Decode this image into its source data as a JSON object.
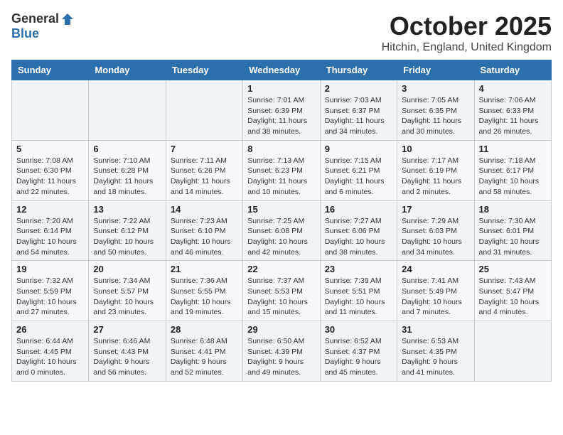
{
  "header": {
    "logo_general": "General",
    "logo_blue": "Blue",
    "month": "October 2025",
    "location": "Hitchin, England, United Kingdom"
  },
  "days_of_week": [
    "Sunday",
    "Monday",
    "Tuesday",
    "Wednesday",
    "Thursday",
    "Friday",
    "Saturday"
  ],
  "weeks": [
    [
      {
        "day": "",
        "info": ""
      },
      {
        "day": "",
        "info": ""
      },
      {
        "day": "",
        "info": ""
      },
      {
        "day": "1",
        "info": "Sunrise: 7:01 AM\nSunset: 6:39 PM\nDaylight: 11 hours\nand 38 minutes."
      },
      {
        "day": "2",
        "info": "Sunrise: 7:03 AM\nSunset: 6:37 PM\nDaylight: 11 hours\nand 34 minutes."
      },
      {
        "day": "3",
        "info": "Sunrise: 7:05 AM\nSunset: 6:35 PM\nDaylight: 11 hours\nand 30 minutes."
      },
      {
        "day": "4",
        "info": "Sunrise: 7:06 AM\nSunset: 6:33 PM\nDaylight: 11 hours\nand 26 minutes."
      }
    ],
    [
      {
        "day": "5",
        "info": "Sunrise: 7:08 AM\nSunset: 6:30 PM\nDaylight: 11 hours\nand 22 minutes."
      },
      {
        "day": "6",
        "info": "Sunrise: 7:10 AM\nSunset: 6:28 PM\nDaylight: 11 hours\nand 18 minutes."
      },
      {
        "day": "7",
        "info": "Sunrise: 7:11 AM\nSunset: 6:26 PM\nDaylight: 11 hours\nand 14 minutes."
      },
      {
        "day": "8",
        "info": "Sunrise: 7:13 AM\nSunset: 6:23 PM\nDaylight: 11 hours\nand 10 minutes."
      },
      {
        "day": "9",
        "info": "Sunrise: 7:15 AM\nSunset: 6:21 PM\nDaylight: 11 hours\nand 6 minutes."
      },
      {
        "day": "10",
        "info": "Sunrise: 7:17 AM\nSunset: 6:19 PM\nDaylight: 11 hours\nand 2 minutes."
      },
      {
        "day": "11",
        "info": "Sunrise: 7:18 AM\nSunset: 6:17 PM\nDaylight: 10 hours\nand 58 minutes."
      }
    ],
    [
      {
        "day": "12",
        "info": "Sunrise: 7:20 AM\nSunset: 6:14 PM\nDaylight: 10 hours\nand 54 minutes."
      },
      {
        "day": "13",
        "info": "Sunrise: 7:22 AM\nSunset: 6:12 PM\nDaylight: 10 hours\nand 50 minutes."
      },
      {
        "day": "14",
        "info": "Sunrise: 7:23 AM\nSunset: 6:10 PM\nDaylight: 10 hours\nand 46 minutes."
      },
      {
        "day": "15",
        "info": "Sunrise: 7:25 AM\nSunset: 6:08 PM\nDaylight: 10 hours\nand 42 minutes."
      },
      {
        "day": "16",
        "info": "Sunrise: 7:27 AM\nSunset: 6:06 PM\nDaylight: 10 hours\nand 38 minutes."
      },
      {
        "day": "17",
        "info": "Sunrise: 7:29 AM\nSunset: 6:03 PM\nDaylight: 10 hours\nand 34 minutes."
      },
      {
        "day": "18",
        "info": "Sunrise: 7:30 AM\nSunset: 6:01 PM\nDaylight: 10 hours\nand 31 minutes."
      }
    ],
    [
      {
        "day": "19",
        "info": "Sunrise: 7:32 AM\nSunset: 5:59 PM\nDaylight: 10 hours\nand 27 minutes."
      },
      {
        "day": "20",
        "info": "Sunrise: 7:34 AM\nSunset: 5:57 PM\nDaylight: 10 hours\nand 23 minutes."
      },
      {
        "day": "21",
        "info": "Sunrise: 7:36 AM\nSunset: 5:55 PM\nDaylight: 10 hours\nand 19 minutes."
      },
      {
        "day": "22",
        "info": "Sunrise: 7:37 AM\nSunset: 5:53 PM\nDaylight: 10 hours\nand 15 minutes."
      },
      {
        "day": "23",
        "info": "Sunrise: 7:39 AM\nSunset: 5:51 PM\nDaylight: 10 hours\nand 11 minutes."
      },
      {
        "day": "24",
        "info": "Sunrise: 7:41 AM\nSunset: 5:49 PM\nDaylight: 10 hours\nand 7 minutes."
      },
      {
        "day": "25",
        "info": "Sunrise: 7:43 AM\nSunset: 5:47 PM\nDaylight: 10 hours\nand 4 minutes."
      }
    ],
    [
      {
        "day": "26",
        "info": "Sunrise: 6:44 AM\nSunset: 4:45 PM\nDaylight: 10 hours\nand 0 minutes."
      },
      {
        "day": "27",
        "info": "Sunrise: 6:46 AM\nSunset: 4:43 PM\nDaylight: 9 hours\nand 56 minutes."
      },
      {
        "day": "28",
        "info": "Sunrise: 6:48 AM\nSunset: 4:41 PM\nDaylight: 9 hours\nand 52 minutes."
      },
      {
        "day": "29",
        "info": "Sunrise: 6:50 AM\nSunset: 4:39 PM\nDaylight: 9 hours\nand 49 minutes."
      },
      {
        "day": "30",
        "info": "Sunrise: 6:52 AM\nSunset: 4:37 PM\nDaylight: 9 hours\nand 45 minutes."
      },
      {
        "day": "31",
        "info": "Sunrise: 6:53 AM\nSunset: 4:35 PM\nDaylight: 9 hours\nand 41 minutes."
      },
      {
        "day": "",
        "info": ""
      }
    ]
  ]
}
